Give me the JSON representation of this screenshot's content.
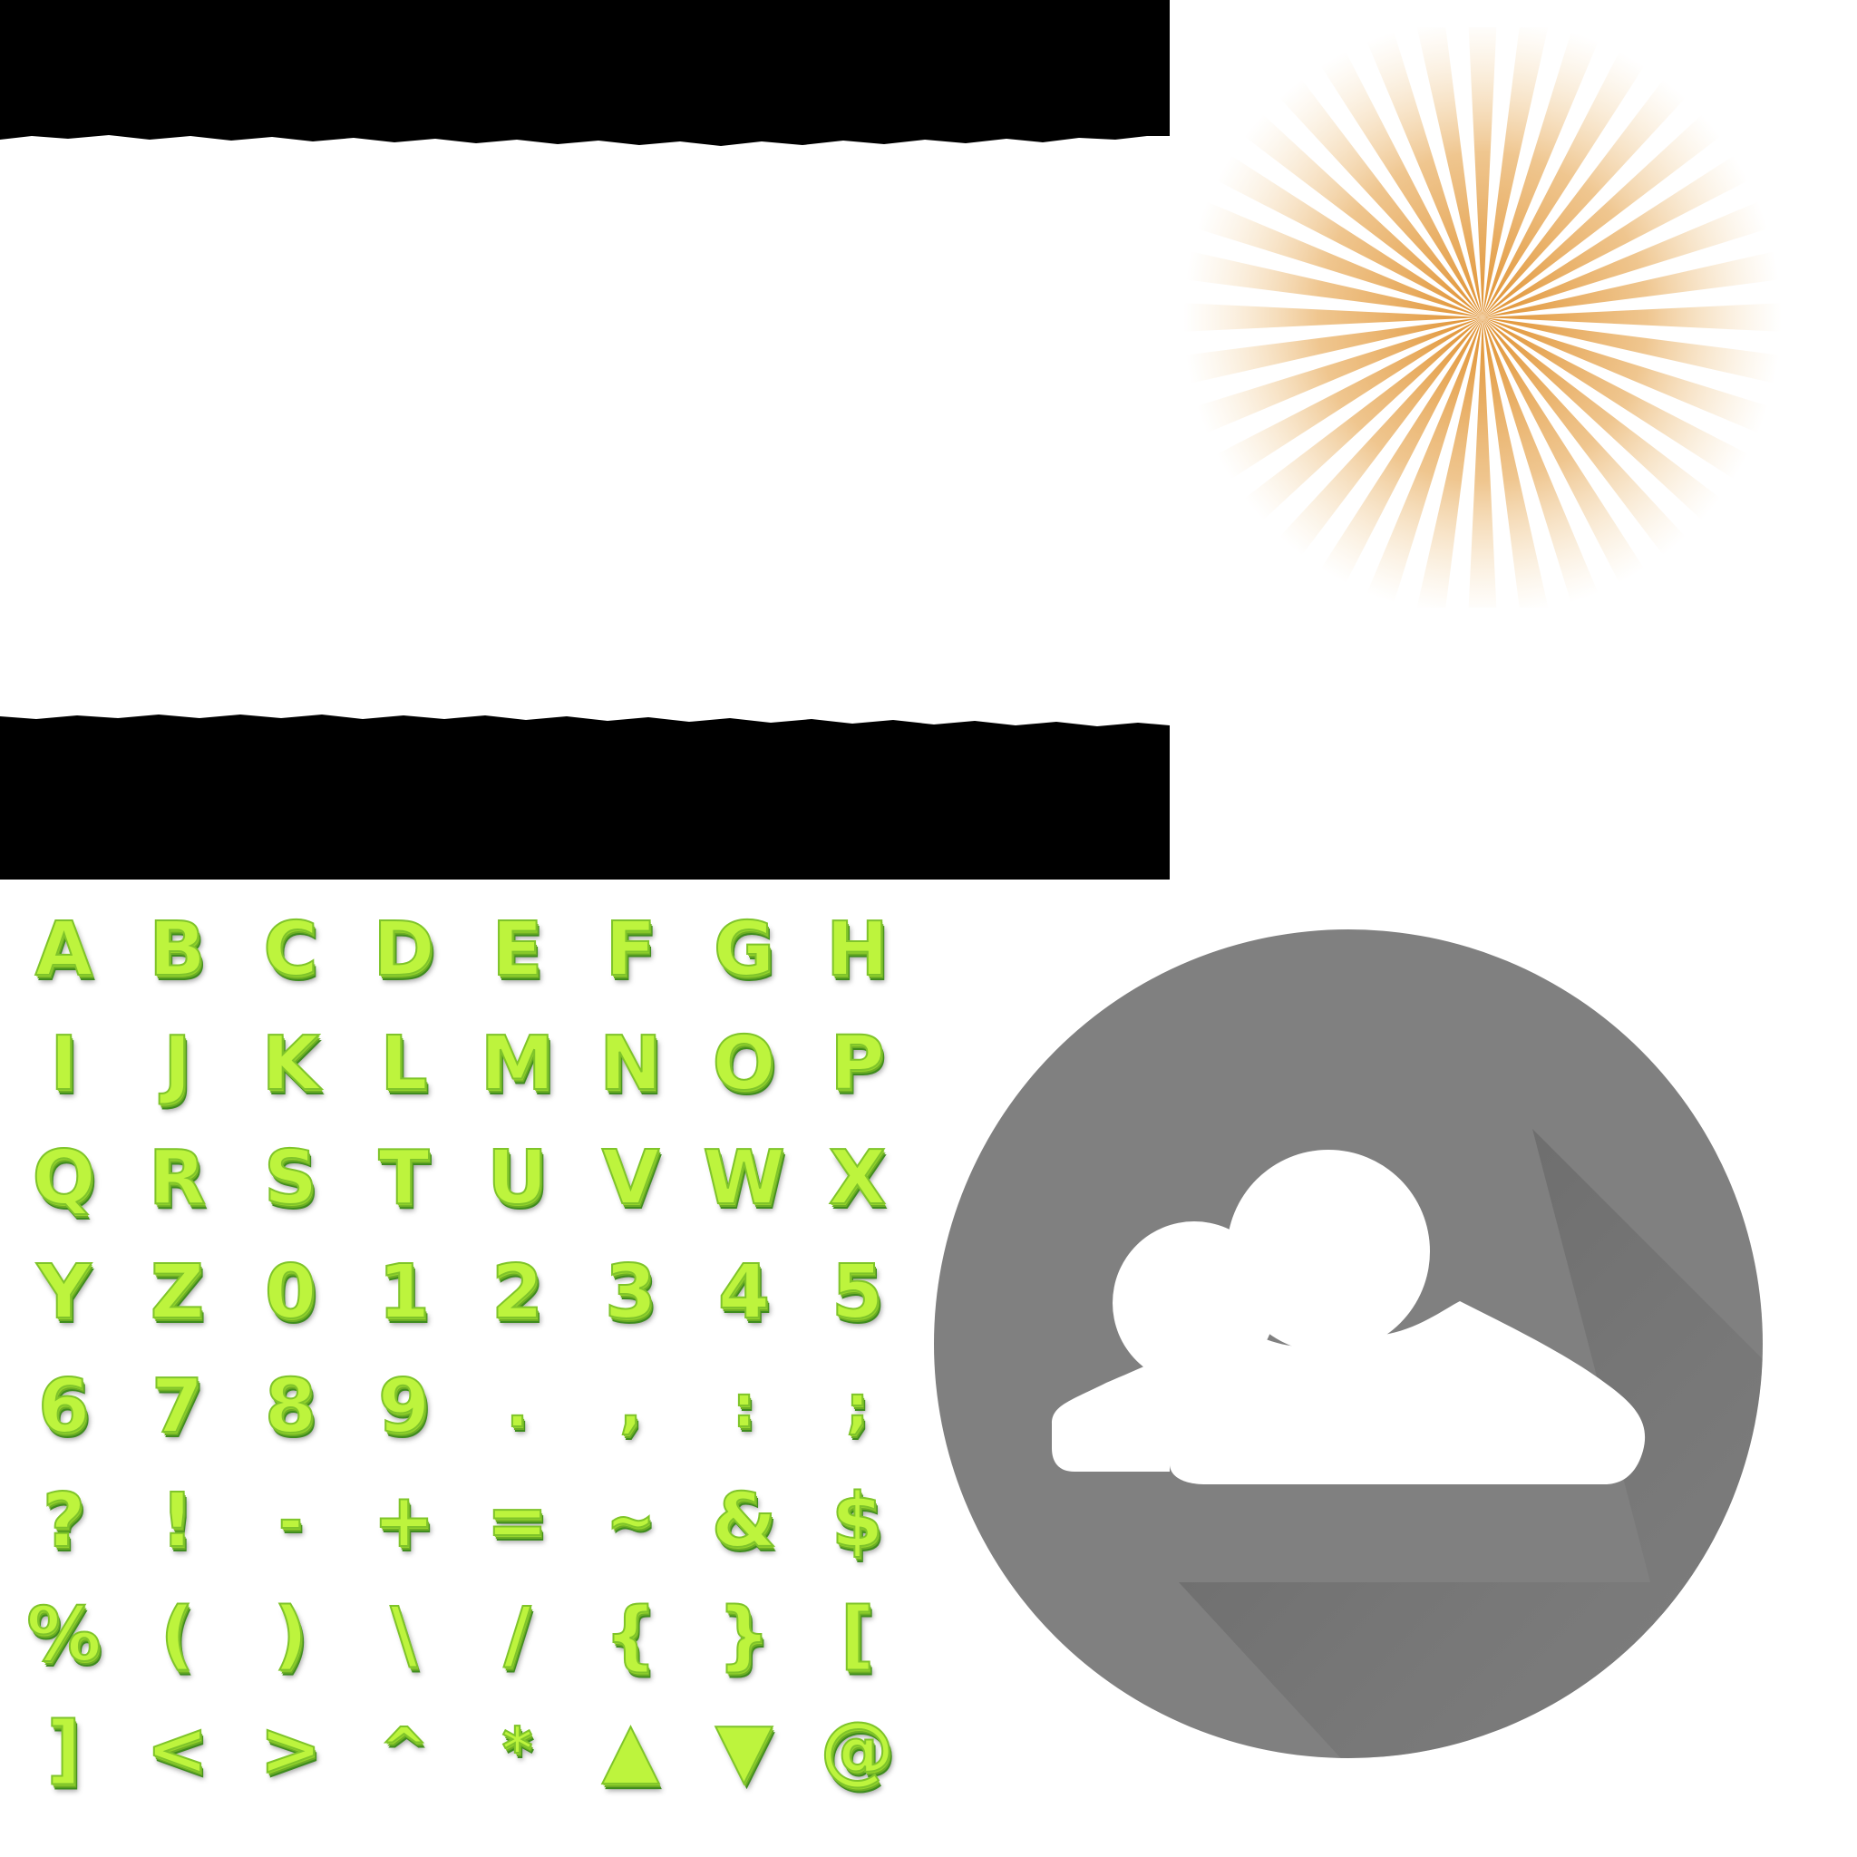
{
  "colors": {
    "banner_black": "#000000",
    "sunburst_ray": "#e8a24a",
    "glyph_fill": "#bdf43d",
    "glyph_side": "#4a9a22",
    "avatar_circle": "#808080",
    "avatar_figure": "#ffffff"
  },
  "icons": {
    "sunburst": "sunburst-icon",
    "avatar": "users-group-icon"
  },
  "glyphs": [
    "A",
    "B",
    "C",
    "D",
    "E",
    "F",
    "G",
    "H",
    "I",
    "J",
    "K",
    "L",
    "M",
    "N",
    "O",
    "P",
    "Q",
    "R",
    "S",
    "T",
    "U",
    "V",
    "W",
    "X",
    "Y",
    "Z",
    "0",
    "1",
    "2",
    "3",
    "4",
    "5",
    "6",
    "7",
    "8",
    "9",
    ".",
    ",",
    ":",
    ";",
    "?",
    "!",
    "-",
    "+",
    "=",
    "~",
    "&",
    "$",
    "%",
    "(",
    ")",
    "\\",
    "/",
    "{",
    "}",
    "[",
    "]",
    "<",
    ">",
    "^",
    "*",
    "▲",
    "▼",
    "@"
  ]
}
